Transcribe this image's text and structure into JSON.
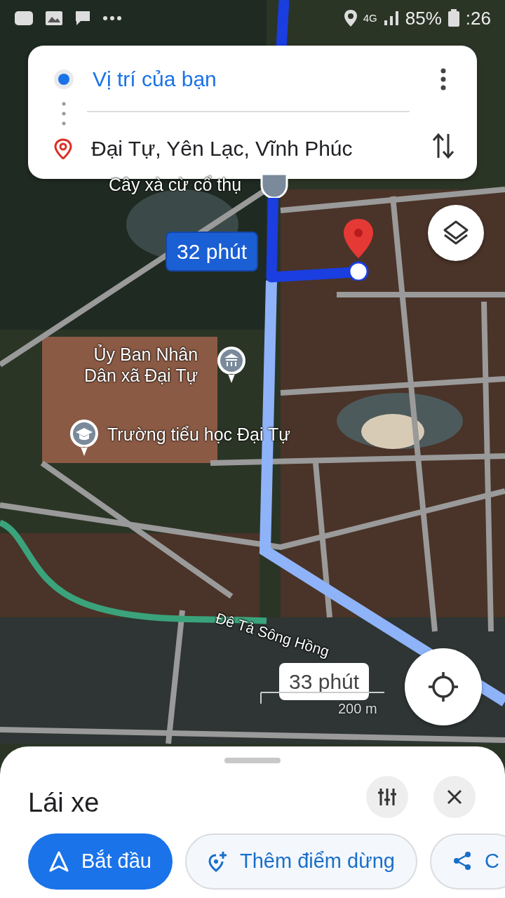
{
  "status_bar": {
    "network": "4G",
    "battery": "85%",
    "time": ":26"
  },
  "directions": {
    "origin": "Vị trí của bạn",
    "destination": "Đại Tự, Yên Lạc, Vĩnh Phúc"
  },
  "map": {
    "labels": [
      {
        "text": "Cây xà cừ cổ thụ",
        "kind": "place"
      },
      {
        "text": "Ủy Ban Nhân\nDân xã Đại Tự",
        "kind": "government"
      },
      {
        "text": "Trường tiểu học Đại Tự",
        "kind": "school"
      },
      {
        "text": "Đê Tả Sông Hồng",
        "kind": "road"
      }
    ],
    "route_callouts": [
      {
        "text": "32 phút",
        "selected": true
      },
      {
        "text": "33 phút",
        "selected": false
      }
    ],
    "scale": "200 m"
  },
  "sheet": {
    "title": "Lái xe",
    "buttons": [
      {
        "label": "Bắt đầu",
        "kind": "start"
      },
      {
        "label": "Thêm điểm dừng",
        "kind": "add-stop"
      },
      {
        "label": "C",
        "kind": "share"
      }
    ]
  }
}
